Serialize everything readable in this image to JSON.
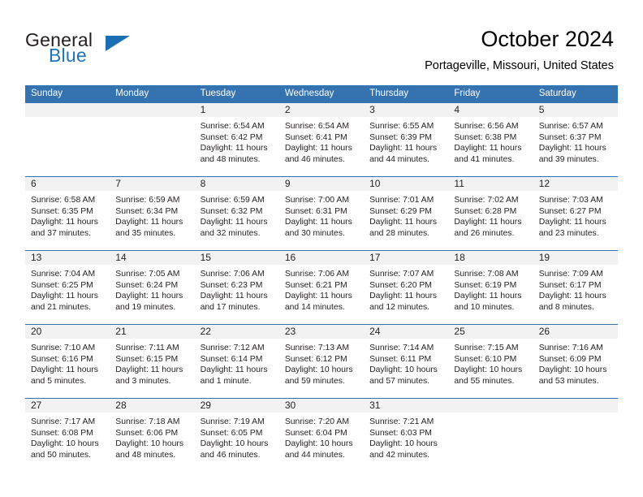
{
  "brand": {
    "name_part1": "General",
    "name_part2": "Blue",
    "triangle_color": "#1c6fb4",
    "blue_color": "#1c75bc"
  },
  "header": {
    "title": "October 2024",
    "location": "Portageville, Missouri, United States"
  },
  "theme": {
    "header_row_bg": "#3572b0",
    "daynum_band_bg": "#f2f2f2",
    "row_divider": "#3572b0",
    "text": "#231f20"
  },
  "weekday_headers": [
    "Sunday",
    "Monday",
    "Tuesday",
    "Wednesday",
    "Thursday",
    "Friday",
    "Saturday"
  ],
  "weeks": [
    [
      {
        "day": "",
        "lines": []
      },
      {
        "day": "",
        "lines": []
      },
      {
        "day": "1",
        "lines": [
          "Sunrise: 6:54 AM",
          "Sunset: 6:42 PM",
          "Daylight: 11 hours",
          "and 48 minutes."
        ]
      },
      {
        "day": "2",
        "lines": [
          "Sunrise: 6:54 AM",
          "Sunset: 6:41 PM",
          "Daylight: 11 hours",
          "and 46 minutes."
        ]
      },
      {
        "day": "3",
        "lines": [
          "Sunrise: 6:55 AM",
          "Sunset: 6:39 PM",
          "Daylight: 11 hours",
          "and 44 minutes."
        ]
      },
      {
        "day": "4",
        "lines": [
          "Sunrise: 6:56 AM",
          "Sunset: 6:38 PM",
          "Daylight: 11 hours",
          "and 41 minutes."
        ]
      },
      {
        "day": "5",
        "lines": [
          "Sunrise: 6:57 AM",
          "Sunset: 6:37 PM",
          "Daylight: 11 hours",
          "and 39 minutes."
        ]
      }
    ],
    [
      {
        "day": "6",
        "lines": [
          "Sunrise: 6:58 AM",
          "Sunset: 6:35 PM",
          "Daylight: 11 hours",
          "and 37 minutes."
        ]
      },
      {
        "day": "7",
        "lines": [
          "Sunrise: 6:59 AM",
          "Sunset: 6:34 PM",
          "Daylight: 11 hours",
          "and 35 minutes."
        ]
      },
      {
        "day": "8",
        "lines": [
          "Sunrise: 6:59 AM",
          "Sunset: 6:32 PM",
          "Daylight: 11 hours",
          "and 32 minutes."
        ]
      },
      {
        "day": "9",
        "lines": [
          "Sunrise: 7:00 AM",
          "Sunset: 6:31 PM",
          "Daylight: 11 hours",
          "and 30 minutes."
        ]
      },
      {
        "day": "10",
        "lines": [
          "Sunrise: 7:01 AM",
          "Sunset: 6:29 PM",
          "Daylight: 11 hours",
          "and 28 minutes."
        ]
      },
      {
        "day": "11",
        "lines": [
          "Sunrise: 7:02 AM",
          "Sunset: 6:28 PM",
          "Daylight: 11 hours",
          "and 26 minutes."
        ]
      },
      {
        "day": "12",
        "lines": [
          "Sunrise: 7:03 AM",
          "Sunset: 6:27 PM",
          "Daylight: 11 hours",
          "and 23 minutes."
        ]
      }
    ],
    [
      {
        "day": "13",
        "lines": [
          "Sunrise: 7:04 AM",
          "Sunset: 6:25 PM",
          "Daylight: 11 hours",
          "and 21 minutes."
        ]
      },
      {
        "day": "14",
        "lines": [
          "Sunrise: 7:05 AM",
          "Sunset: 6:24 PM",
          "Daylight: 11 hours",
          "and 19 minutes."
        ]
      },
      {
        "day": "15",
        "lines": [
          "Sunrise: 7:06 AM",
          "Sunset: 6:23 PM",
          "Daylight: 11 hours",
          "and 17 minutes."
        ]
      },
      {
        "day": "16",
        "lines": [
          "Sunrise: 7:06 AM",
          "Sunset: 6:21 PM",
          "Daylight: 11 hours",
          "and 14 minutes."
        ]
      },
      {
        "day": "17",
        "lines": [
          "Sunrise: 7:07 AM",
          "Sunset: 6:20 PM",
          "Daylight: 11 hours",
          "and 12 minutes."
        ]
      },
      {
        "day": "18",
        "lines": [
          "Sunrise: 7:08 AM",
          "Sunset: 6:19 PM",
          "Daylight: 11 hours",
          "and 10 minutes."
        ]
      },
      {
        "day": "19",
        "lines": [
          "Sunrise: 7:09 AM",
          "Sunset: 6:17 PM",
          "Daylight: 11 hours",
          "and 8 minutes."
        ]
      }
    ],
    [
      {
        "day": "20",
        "lines": [
          "Sunrise: 7:10 AM",
          "Sunset: 6:16 PM",
          "Daylight: 11 hours",
          "and 5 minutes."
        ]
      },
      {
        "day": "21",
        "lines": [
          "Sunrise: 7:11 AM",
          "Sunset: 6:15 PM",
          "Daylight: 11 hours",
          "and 3 minutes."
        ]
      },
      {
        "day": "22",
        "lines": [
          "Sunrise: 7:12 AM",
          "Sunset: 6:14 PM",
          "Daylight: 11 hours",
          "and 1 minute."
        ]
      },
      {
        "day": "23",
        "lines": [
          "Sunrise: 7:13 AM",
          "Sunset: 6:12 PM",
          "Daylight: 10 hours",
          "and 59 minutes."
        ]
      },
      {
        "day": "24",
        "lines": [
          "Sunrise: 7:14 AM",
          "Sunset: 6:11 PM",
          "Daylight: 10 hours",
          "and 57 minutes."
        ]
      },
      {
        "day": "25",
        "lines": [
          "Sunrise: 7:15 AM",
          "Sunset: 6:10 PM",
          "Daylight: 10 hours",
          "and 55 minutes."
        ]
      },
      {
        "day": "26",
        "lines": [
          "Sunrise: 7:16 AM",
          "Sunset: 6:09 PM",
          "Daylight: 10 hours",
          "and 53 minutes."
        ]
      }
    ],
    [
      {
        "day": "27",
        "lines": [
          "Sunrise: 7:17 AM",
          "Sunset: 6:08 PM",
          "Daylight: 10 hours",
          "and 50 minutes."
        ]
      },
      {
        "day": "28",
        "lines": [
          "Sunrise: 7:18 AM",
          "Sunset: 6:06 PM",
          "Daylight: 10 hours",
          "and 48 minutes."
        ]
      },
      {
        "day": "29",
        "lines": [
          "Sunrise: 7:19 AM",
          "Sunset: 6:05 PM",
          "Daylight: 10 hours",
          "and 46 minutes."
        ]
      },
      {
        "day": "30",
        "lines": [
          "Sunrise: 7:20 AM",
          "Sunset: 6:04 PM",
          "Daylight: 10 hours",
          "and 44 minutes."
        ]
      },
      {
        "day": "31",
        "lines": [
          "Sunrise: 7:21 AM",
          "Sunset: 6:03 PM",
          "Daylight: 10 hours",
          "and 42 minutes."
        ]
      },
      {
        "day": "",
        "lines": []
      },
      {
        "day": "",
        "lines": []
      }
    ]
  ]
}
